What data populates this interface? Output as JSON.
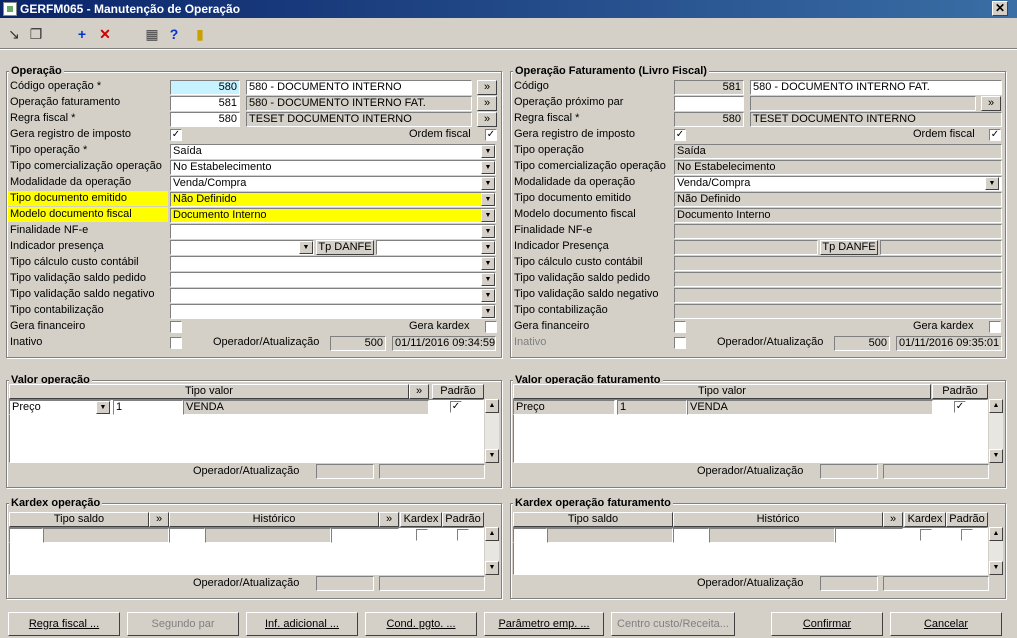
{
  "window": {
    "title": "GERFM065 - Manutenção de Operação",
    "close": "✕"
  },
  "toolbar": {
    "nav": "↘",
    "copy": "❐",
    "add": "+",
    "delete": "✕",
    "calc": "▦",
    "help": "?",
    "exit": "▮"
  },
  "left": {
    "title": "Operação",
    "labels": [
      "Código operação *",
      "Operação faturamento",
      "Regra fiscal *",
      "Gera registro de imposto",
      "Tipo operação *",
      "Tipo comercialização operação",
      "Modalidade da operação",
      "Tipo documento emitido",
      "Modelo documento fiscal",
      "Finalidade NF-e",
      "Indicador presença",
      "Tipo cálculo custo contábil",
      "Tipo validação saldo pedido",
      "Tipo validação saldo negativo",
      "Tipo contabilização",
      "Gera financeiro",
      "Inativo"
    ],
    "codigo": "580",
    "codigo_desc": "580 - DOCUMENTO INTERNO",
    "fat": "581",
    "fat_desc": "580 - DOCUMENTO INTERNO FAT.",
    "regra": "580",
    "regra_desc": "TESET DOCUMENTO INTERNO",
    "ordem_fiscal": "Ordem fiscal",
    "tipo_operacao": "Saída",
    "tipo_comerc": "No Estabelecimento",
    "modalidade": "Venda/Compra",
    "tipo_doc": "Não Definido",
    "modelo_doc": "Documento Interno",
    "tp_danfe": "Tp DANFE",
    "gera_kardex": "Gera kardex",
    "operador_label": "Operador/Atualização",
    "operador": "500",
    "atualizacao": "01/11/2016 09:34:59",
    "check": "✓",
    "more": "»",
    "arrow": "▼"
  },
  "right": {
    "title": "Operação Faturamento (Livro Fiscal)",
    "labels": [
      "Código",
      "Operação próximo par",
      "Regra fiscal *",
      "Gera registro de imposto",
      "Tipo operação",
      "Tipo comercialização operação",
      "Modalidade da operação",
      "Tipo documento emitido",
      "Modelo documento fiscal",
      "Finalidade NF-e",
      "Indicador Presença",
      "Tipo cálculo custo contábil",
      "Tipo validação saldo pedido",
      "Tipo validação saldo negativo",
      "Tipo contabilização",
      "Gera financeiro",
      "Inativo"
    ],
    "codigo": "581",
    "codigo_desc": "580 - DOCUMENTO INTERNO FAT.",
    "regra": "580",
    "regra_desc": "TESET DOCUMENTO INTERNO",
    "ordem_fiscal": "Ordem fiscal",
    "tipo_operacao": "Saída",
    "tipo_comerc": "No Estabelecimento",
    "modalidade": "Venda/Compra",
    "tipo_doc": "Não Definido",
    "modelo_doc": "Documento Interno",
    "tp_danfe": "Tp DANFE",
    "gera_kardex": "Gera kardex",
    "operador_label": "Operador/Atualização",
    "operador": "500",
    "atualizacao": "01/11/2016 09:35:01"
  },
  "valor_left": {
    "title": "Valor operação",
    "col_tipo": "Tipo valor",
    "col_padrao": "Padrão",
    "tipo": "Preço",
    "num": "1",
    "desc": "VENDA",
    "operador_label": "Operador/Atualização"
  },
  "valor_right": {
    "title": "Valor operação faturamento",
    "col_tipo": "Tipo valor",
    "col_padrao": "Padrão",
    "tipo": "Preço",
    "num": "1",
    "desc": "VENDA",
    "operador_label": "Operador/Atualização"
  },
  "kardex_left": {
    "title": "Kardex operação",
    "col_tipo": "Tipo saldo",
    "col_hist": "Histórico",
    "col_kardex": "Kardex",
    "col_padrao": "Padrão",
    "operador_label": "Operador/Atualização"
  },
  "kardex_right": {
    "title": "Kardex operação faturamento",
    "col_tipo": "Tipo saldo",
    "col_hist": "Histórico",
    "col_kardex": "Kardex",
    "col_padrao": "Padrão",
    "operador_label": "Operador/Atualização"
  },
  "buttons": [
    "Regra fiscal ...",
    "Segundo par",
    "Inf. adicional ...",
    "Cond. pgto. ...",
    "Parâmetro emp. ...",
    "Centro custo/Receita...",
    "Confirmar",
    "Cancelar"
  ],
  "scroll": {
    "up": "▲",
    "down": "▼"
  }
}
